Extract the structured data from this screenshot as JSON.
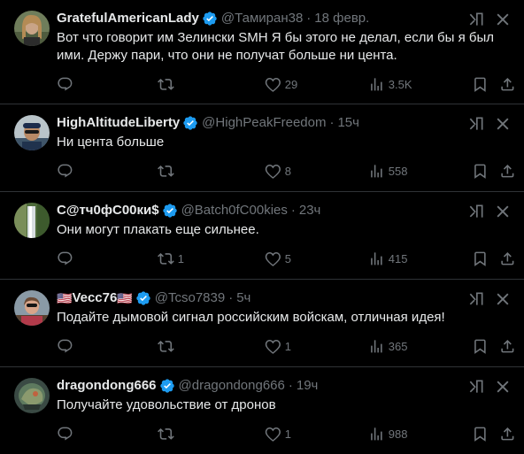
{
  "colors": {
    "background": "#000000",
    "text": "#e7e9ea",
    "muted": "#71767b",
    "verified": "#1d9bf0",
    "divider": "#2f3336"
  },
  "tweets": [
    {
      "name": "GratefulAmericanLady",
      "handle": "@Тамиран38",
      "time": "18 февр.",
      "text": "Вот что говорит им Зелински SMH Я бы этого не делал, если бы я был ими. Держу пари, что они не получат больше ни цента.",
      "replies": "",
      "retweets": "",
      "likes": "29",
      "views": "3.5K"
    },
    {
      "name": "HighAltitudeLiberty",
      "handle": "@HighPeakFreedom",
      "time": "15ч",
      "text": "Ни цента больше",
      "replies": "",
      "retweets": "",
      "likes": "8",
      "views": "558"
    },
    {
      "name": "C@тч0фC00ки$",
      "handle": "@Batch0fC00kies",
      "time": "23ч",
      "text": "Они могут плакать еще сильнее.",
      "replies": "",
      "retweets": "1",
      "likes": "5",
      "views": "415"
    },
    {
      "name": "Vecc76",
      "flag_left": "🇺🇸",
      "flag_right": "🇺🇸",
      "handle": "@Tcso7839",
      "time": "5ч",
      "text": "Подайте дымовой сигнал российским войскам, отличная идея!",
      "replies": "",
      "retweets": "",
      "likes": "1",
      "views": "365"
    },
    {
      "name": "dragondong666",
      "handle": "@dragondong666",
      "time": "19ч",
      "text": "Получайте удовольствие от дронов",
      "replies": "",
      "retweets": "",
      "likes": "1",
      "views": "988"
    }
  ],
  "icons": {
    "verified": "verified-badge-icon",
    "grok": "grok-icon",
    "more": "more-icon",
    "reply": "reply-icon",
    "retweet": "retweet-icon",
    "like": "like-icon",
    "views": "views-icon",
    "bookmark": "bookmark-icon",
    "share": "share-icon"
  }
}
